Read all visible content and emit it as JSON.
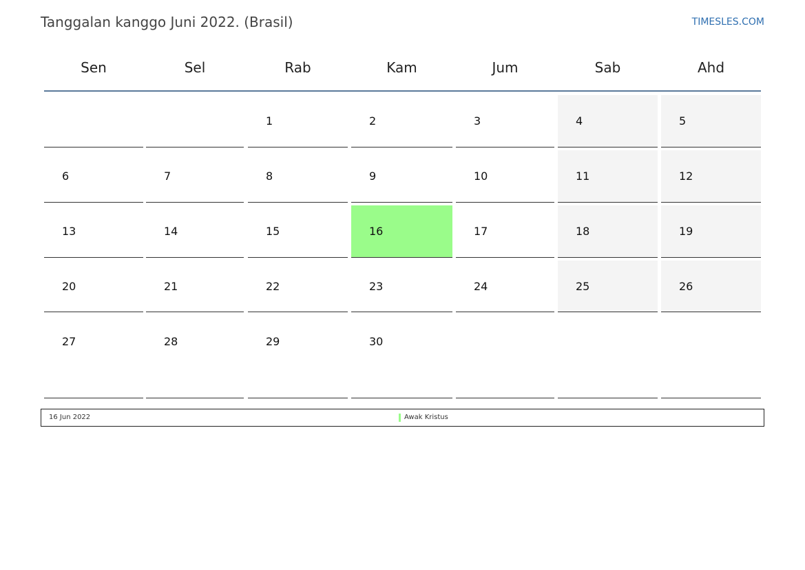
{
  "title": "Tanggalan kanggo Juni 2022. (Brasil)",
  "site": "TIMESLES.COM",
  "weekdays": [
    "Sen",
    "Sel",
    "Rab",
    "Kam",
    "Jum",
    "Sab",
    "Ahd"
  ],
  "weeks": [
    [
      "",
      "",
      "1",
      "2",
      "3",
      "4",
      "5"
    ],
    [
      "6",
      "7",
      "8",
      "9",
      "10",
      "11",
      "12"
    ],
    [
      "13",
      "14",
      "15",
      "16",
      "17",
      "18",
      "19"
    ],
    [
      "20",
      "21",
      "22",
      "23",
      "24",
      "25",
      "26"
    ],
    [
      "27",
      "28",
      "29",
      "30",
      "",
      "",
      ""
    ]
  ],
  "holiday_day": "16",
  "colors": {
    "holiday": "#9afc8a",
    "weekend": "#f4f4f4",
    "header_line": "#5b7a9a",
    "link": "#2f6fb0"
  },
  "legend": {
    "date": "16 Jun 2022",
    "name": "Awak Kristus"
  }
}
